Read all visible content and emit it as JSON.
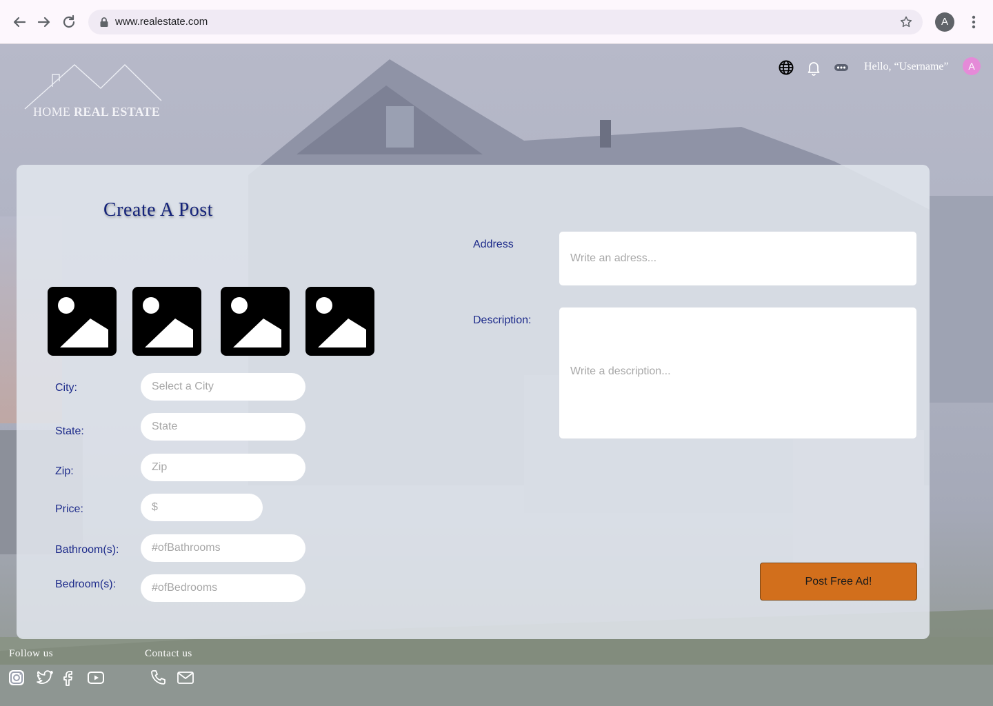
{
  "browser": {
    "url": "www.realestate.com",
    "profile_initial": "A"
  },
  "header": {
    "logo_home": "HOME",
    "logo_real_estate": "REAL ESTATE",
    "greeting": "Hello, “Username”",
    "avatar_initial": "A",
    "icons": [
      "globe-icon",
      "bell-icon",
      "more-icon"
    ]
  },
  "form": {
    "title": "Create A Post",
    "image_slots": [
      "image-placeholder-1",
      "image-placeholder-2",
      "image-placeholder-3",
      "image-placeholder-4"
    ],
    "city": {
      "label": "City:",
      "placeholder": "Select a City"
    },
    "state": {
      "label": "State:",
      "placeholder": "State"
    },
    "zip": {
      "label": "Zip:",
      "placeholder": "Zip"
    },
    "price": {
      "label": "Price:",
      "placeholder": "$"
    },
    "bathrooms": {
      "label": "Bathroom(s):",
      "placeholder": "#ofBathrooms"
    },
    "bedrooms": {
      "label": "Bedroom(s):",
      "placeholder": "#ofBedrooms"
    },
    "address": {
      "label": "Address",
      "placeholder": "Write an adress..."
    },
    "description": {
      "label": "Description:",
      "placeholder": "Write a description..."
    },
    "submit_label": "Post Free Ad!"
  },
  "footer": {
    "follow_us": "Follow us",
    "contact_us": "Contact us",
    "social_icons": [
      "instagram-icon",
      "twitter-icon",
      "facebook-icon",
      "youtube-icon"
    ],
    "contact_icons": [
      "phone-icon",
      "mail-icon"
    ]
  },
  "colors": {
    "title": "#14237a",
    "label": "#1c2a8a",
    "button": "#d26f1c",
    "avatar": "#e58ad8"
  }
}
